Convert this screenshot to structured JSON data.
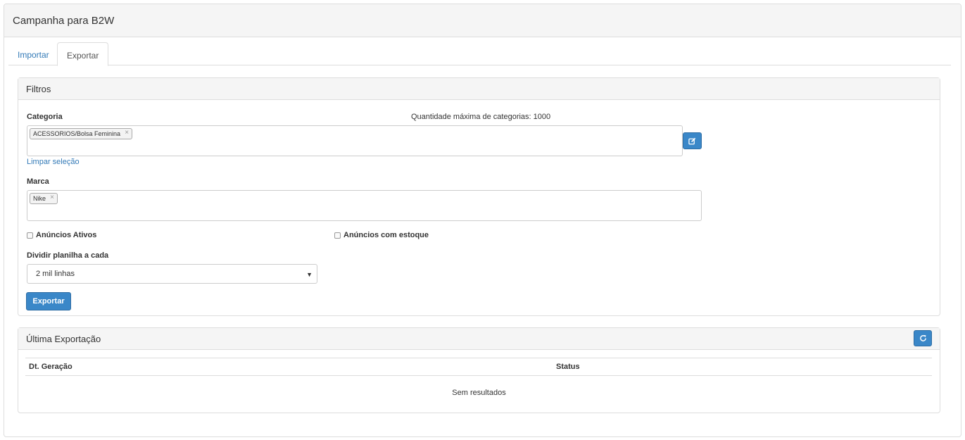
{
  "page": {
    "title": "Campanha para B2W"
  },
  "tabs": [
    {
      "label": "Importar",
      "active": false
    },
    {
      "label": "Exportar",
      "active": true
    }
  ],
  "filters": {
    "heading": "Filtros",
    "category": {
      "label": "Categoria",
      "max_note": "Quantidade máxima de categorias: 1000",
      "selected": [
        "ACESSORIOS/Bolsa Feminina"
      ],
      "clear_label": "Limpar seleção",
      "edit_icon": "edit-icon"
    },
    "brand": {
      "label": "Marca",
      "selected": [
        "Nike"
      ]
    },
    "checkboxes": {
      "active_ads": {
        "label": "Anúncios Ativos",
        "checked": false
      },
      "in_stock": {
        "label": "Anúncios com estoque",
        "checked": false
      }
    },
    "split": {
      "label": "Dividir planilha a cada",
      "value": "2 mil linhas"
    },
    "export_button": "Exportar"
  },
  "last_export": {
    "heading": "Última Exportação",
    "refresh_icon": "refresh-icon",
    "columns": [
      "Dt. Geração",
      "Status"
    ],
    "empty_text": "Sem resultados"
  },
  "colors": {
    "primary": "#3a87c8",
    "link": "#337ab7",
    "border": "#dddddd"
  }
}
